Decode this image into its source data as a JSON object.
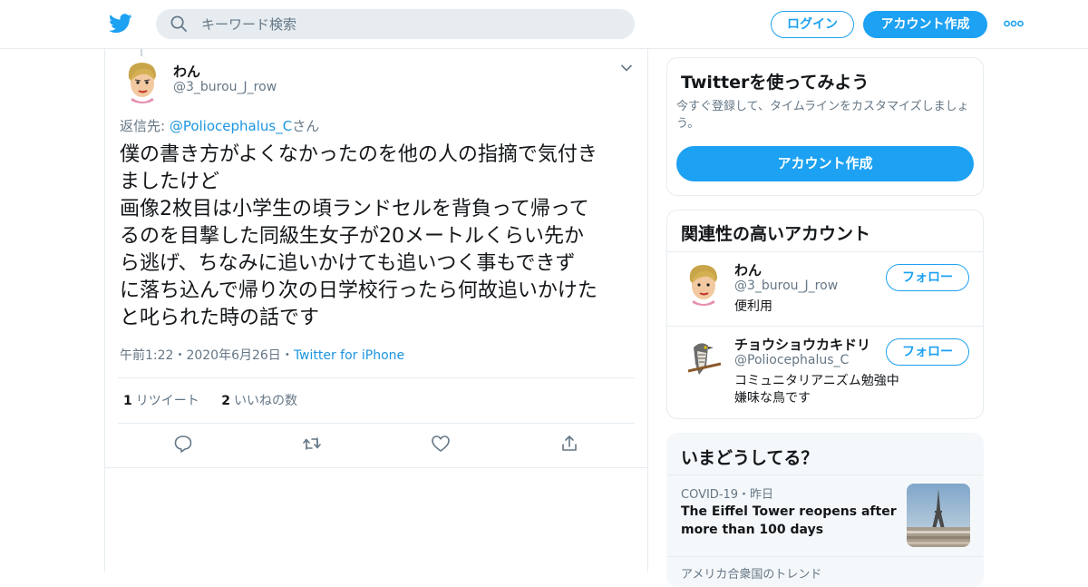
{
  "header": {
    "search_placeholder": "キーワード検索",
    "login_label": "ログイン",
    "signup_label": "アカウント作成"
  },
  "tweet": {
    "name": "わん",
    "handle": "@3_burou_J_row",
    "reply_prefix": "返信先: ",
    "reply_mention": "@Poliocephalus_C",
    "reply_suffix": "さん",
    "text": "僕の書き方がよくなかったのを他の人の指摘で気付き\nましたけど\n画像2枚目は小学生の頃ランドセルを背負って帰って\nるのを目撃した同級生女子が20メートルくらい先か\nら逃げ、ちなみに追いかけても追いつく事もできず\nに落ち込んで帰り次の日学校行ったら何故追いかけた\nと叱られた時の話です",
    "time": "午前1:22",
    "date": "2020年6月26日",
    "source": "Twitter for iPhone",
    "retweet_count": "1",
    "retweet_label": "リツイート",
    "like_count": "2",
    "like_label": "いいねの数"
  },
  "signup_card": {
    "title": "Twitterを使ってみよう",
    "desc": "今すぐ登録して、タイムラインをカスタマイズしましょう。",
    "button": "アカウント作成"
  },
  "related": {
    "title": "関連性の高いアカウント",
    "accounts": [
      {
        "name": "わん",
        "handle": "@3_burou_J_row",
        "bio": "便利用",
        "follow": "フォロー"
      },
      {
        "name": "チョウショウカキドリ",
        "handle": "@Poliocephalus_C",
        "bio": "コミュニタリアニズム勉強中 嫌味な鳥です",
        "follow": "フォロー"
      }
    ]
  },
  "trends": {
    "title": "いまどうしてる？",
    "items": [
      {
        "category": "COVID-19・昨日",
        "title": "The Eiffel Tower reopens after more than 100 days"
      },
      {
        "category": "アメリカ合衆国のトレンド"
      }
    ]
  },
  "colors": {
    "accent": "#1da1f2",
    "link": "#1b95e0",
    "muted": "#657786",
    "border": "#e6ecf0"
  }
}
